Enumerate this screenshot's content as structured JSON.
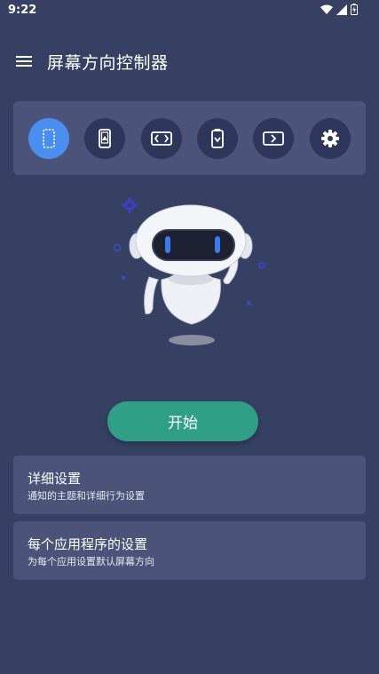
{
  "status": {
    "time": "9:22"
  },
  "app": {
    "title": "屏幕方向控制器"
  },
  "modes": [
    {
      "icon": "portrait-outline-icon",
      "active": true
    },
    {
      "icon": "auto-rotate-portrait-icon",
      "active": false
    },
    {
      "icon": "landscape-arrows-icon",
      "active": false
    },
    {
      "icon": "portrait-lock-icon",
      "active": false
    },
    {
      "icon": "reverse-landscape-icon",
      "active": false
    },
    {
      "icon": "settings-gear-icon",
      "active": false
    }
  ],
  "start_button": {
    "label": "开始"
  },
  "cards": [
    {
      "title": "详细设置",
      "subtitle": "通知的主题和详细行为设置"
    },
    {
      "title": "每个应用程序的设置",
      "subtitle": "为每个应用设置默认屏幕方向"
    }
  ],
  "colors": {
    "background": "#354063",
    "panel": "#4b5478",
    "active": "#4a8ef0",
    "start": "#2f9f85"
  }
}
